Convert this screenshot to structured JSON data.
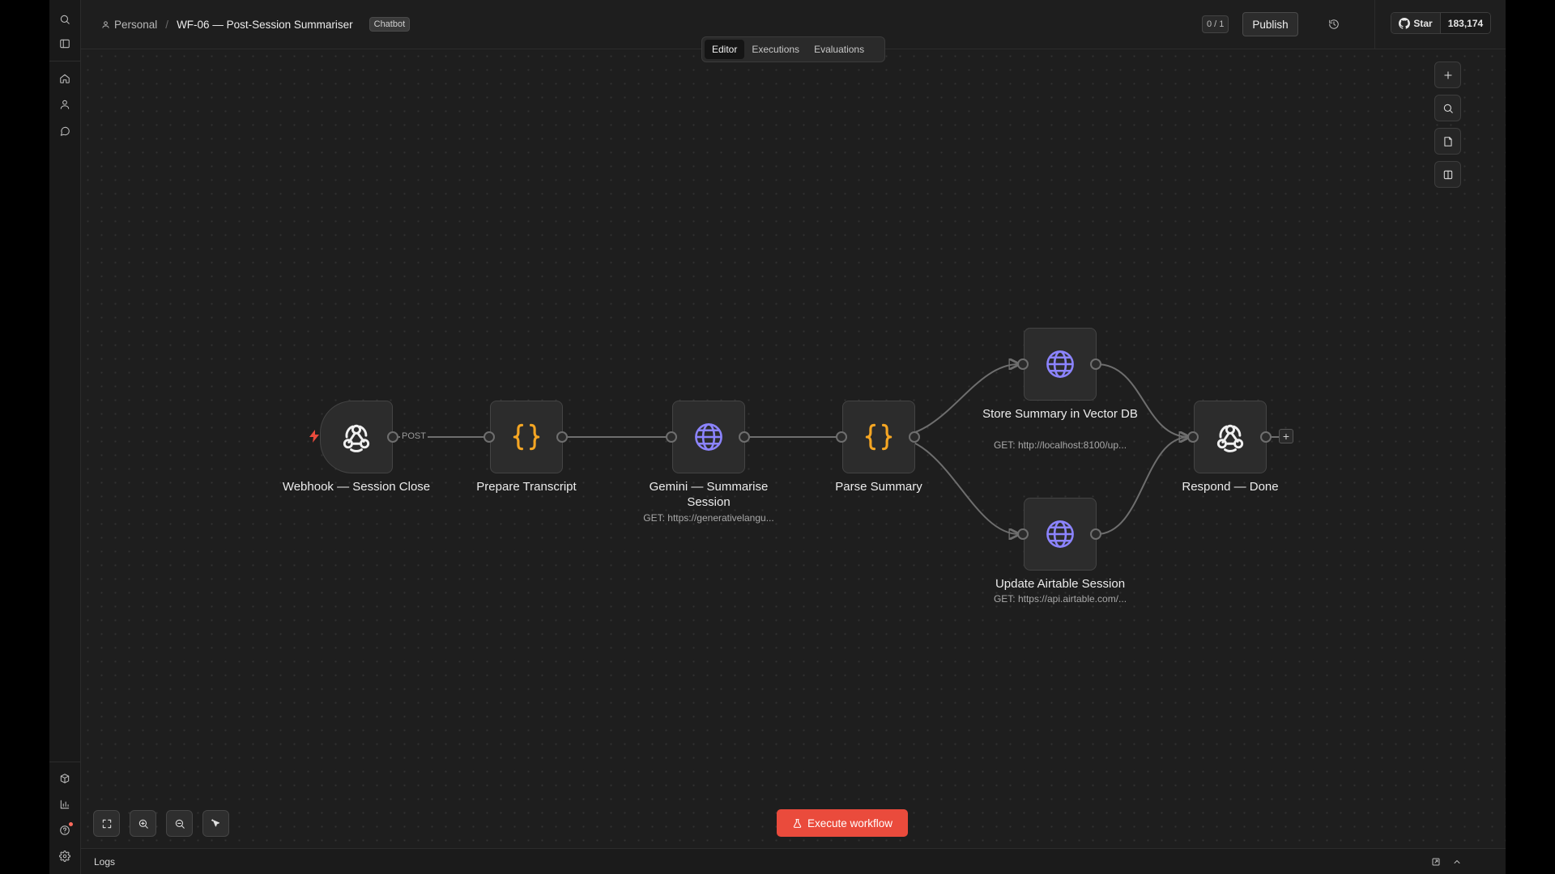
{
  "header": {
    "breadcrumb_owner": "Personal",
    "breadcrumb_separator": "/",
    "workflow_name": "WF-06 — Post-Session Summariser",
    "tag": "Chatbot",
    "counter": "0 / 1",
    "publish_label": "Publish",
    "github_star_label": "Star",
    "github_star_count": "183,174"
  },
  "tabs": [
    {
      "label": "Editor",
      "active": true
    },
    {
      "label": "Executions",
      "active": false
    },
    {
      "label": "Evaluations",
      "active": false
    }
  ],
  "nodes": [
    {
      "label": "Webhook — Session Close",
      "subtitle": "",
      "icon": "webhook-icon"
    },
    {
      "label": "Prepare Transcript",
      "subtitle": "",
      "icon": "code-braces-icon"
    },
    {
      "label": "Gemini — Summarise Session",
      "subtitle": "GET: https://generativelangu...",
      "icon": "globe-icon"
    },
    {
      "label": "Parse Summary",
      "subtitle": "",
      "icon": "code-braces-icon"
    },
    {
      "label": "Store Summary in Vector DB",
      "subtitle": "GET: http://localhost:8100/up...",
      "icon": "globe-icon"
    },
    {
      "label": "Update Airtable Session",
      "subtitle": "GET: https://api.airtable.com/...",
      "icon": "globe-icon"
    },
    {
      "label": "Respond — Done",
      "subtitle": "",
      "icon": "webhook-icon"
    }
  ],
  "edge_label_post": "POST",
  "execute_label": "Execute workflow",
  "logs_label": "Logs",
  "colors": {
    "accent": "#ea4b3c",
    "code_icon": "#f5a623",
    "http_icon": "#8c84ff",
    "canvas_bg": "#1e1e1e"
  }
}
